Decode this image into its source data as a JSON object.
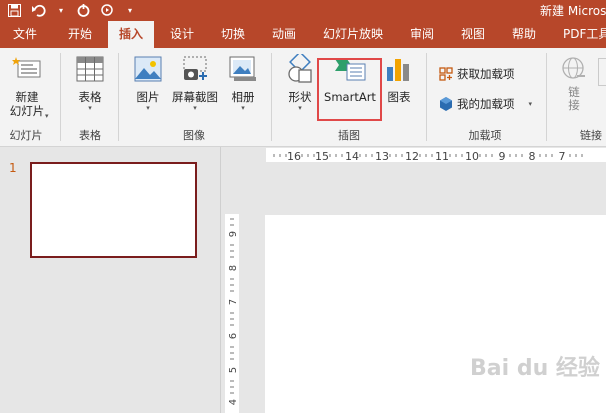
{
  "title_bar": {
    "title": "新建 Micros"
  },
  "tabs": [
    "文件",
    "开始",
    "插入",
    "设计",
    "切换",
    "动画",
    "幻灯片放映",
    "审阅",
    "视图",
    "帮助",
    "PDF工具"
  ],
  "active_tab": "插入",
  "ribbon": {
    "new_slide": {
      "line1": "新建",
      "line2": "幻灯片"
    },
    "slides_group": "幻灯片",
    "table_btn": "表格",
    "table_group": "表格",
    "picture_btn": "图片",
    "screenshot_btn": "屏幕截图",
    "album_btn": "相册",
    "images_group": "图像",
    "shapes_btn": "形状",
    "smartart_btn": "SmartArt",
    "chart_btn": "图表",
    "illustrations_group": "插图",
    "get_addins": "获取加载项",
    "my_addins": "我的加载项",
    "addins_group": "加载项",
    "link_btn": "链接",
    "links_group": "链接"
  },
  "slides": [
    {
      "number": "1"
    }
  ],
  "hruler_labels": [
    "16",
    "15",
    "14",
    "13",
    "12",
    "11",
    "10",
    "9",
    "8",
    "7"
  ],
  "vruler_labels": [
    "9",
    "8",
    "7",
    "6",
    "5",
    "4"
  ],
  "watermark": "Bai du 经验",
  "colors": {
    "brand": "#b7472a",
    "highlight": "#e04848",
    "slide_border": "#7a1d1d"
  }
}
